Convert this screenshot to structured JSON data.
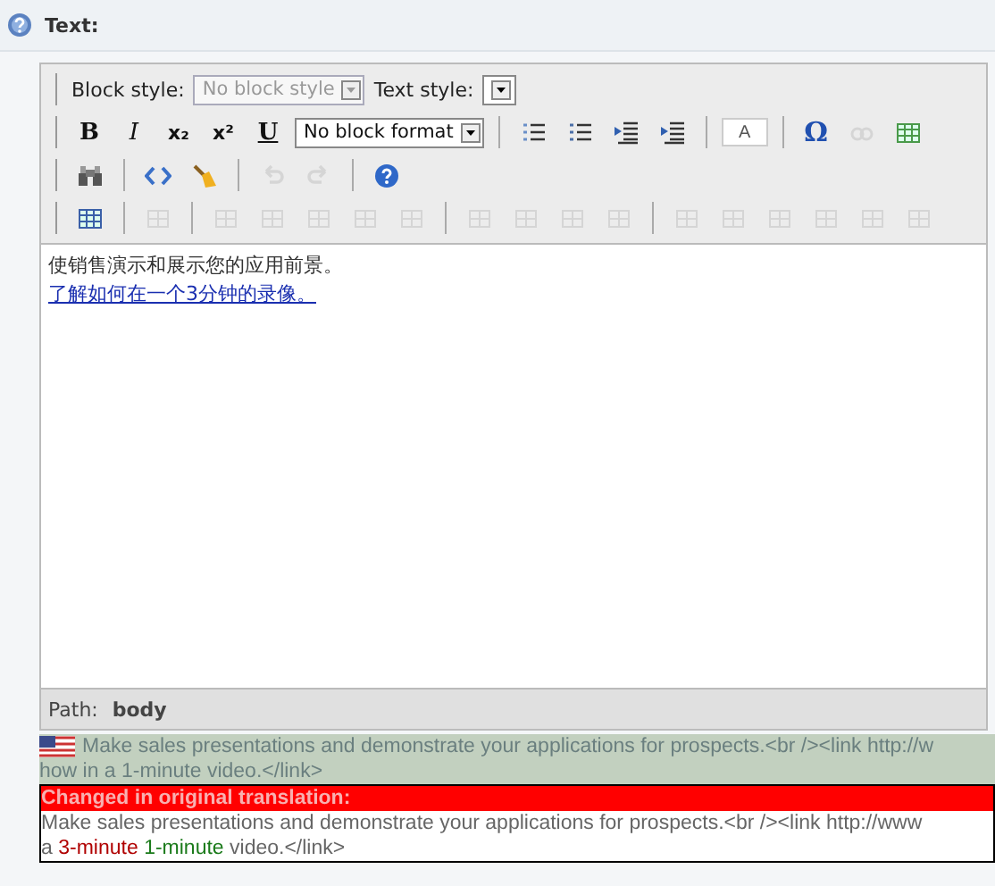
{
  "field": {
    "label": "Text:"
  },
  "toolbar": {
    "rows": [
      {
        "items": [
          {
            "kind": "label",
            "text": "Block style:"
          },
          {
            "kind": "select",
            "value": "No block style",
            "disabled": true
          },
          {
            "kind": "label",
            "text": "Text style:"
          },
          {
            "kind": "select",
            "disabled": false
          }
        ]
      },
      {
        "items": [
          {
            "kind": "glyph",
            "text": "B",
            "disabled": false
          },
          {
            "kind": "glyph",
            "text": "I",
            "disabled": false
          },
          {
            "kind": "glyph",
            "text": "x₂",
            "disabled": false
          },
          {
            "kind": "glyph",
            "text": "x²",
            "disabled": false
          },
          {
            "kind": "glyph",
            "text": "U",
            "disabled": false
          },
          {
            "kind": "select",
            "value": "No block format",
            "disabled": false
          },
          {
            "kind": "sep"
          },
          {
            "kind": "icon",
            "disabled": false
          },
          {
            "kind": "icon",
            "disabled": false
          },
          {
            "kind": "icon",
            "disabled": false
          },
          {
            "kind": "icon",
            "disabled": false
          },
          {
            "kind": "sep"
          },
          {
            "kind": "swatch",
            "text": "A",
            "disabled": false
          },
          {
            "kind": "sep"
          },
          {
            "kind": "glyph",
            "text": "Ω",
            "disabled": false
          },
          {
            "kind": "icon",
            "disabled": true
          },
          {
            "kind": "icon",
            "disabled": false
          }
        ]
      },
      {
        "items": [
          {
            "kind": "icon",
            "disabled": false
          },
          {
            "kind": "sep"
          },
          {
            "kind": "icon",
            "disabled": false
          },
          {
            "kind": "icon",
            "disabled": false
          },
          {
            "kind": "sep"
          },
          {
            "kind": "icon",
            "disabled": true
          },
          {
            "kind": "icon",
            "disabled": true
          },
          {
            "kind": "sep"
          },
          {
            "kind": "icon",
            "disabled": false
          }
        ]
      },
      {
        "items": [
          {
            "kind": "icon",
            "disabled": false
          },
          {
            "kind": "sep"
          },
          {
            "kind": "icon",
            "disabled": true
          },
          {
            "kind": "sep"
          },
          {
            "kind": "icon",
            "disabled": true
          },
          {
            "kind": "icon",
            "disabled": true
          },
          {
            "kind": "icon",
            "disabled": true
          },
          {
            "kind": "icon",
            "disabled": true
          },
          {
            "kind": "icon",
            "disabled": true
          },
          {
            "kind": "sep"
          },
          {
            "kind": "icon",
            "disabled": true
          },
          {
            "kind": "icon",
            "disabled": true
          },
          {
            "kind": "icon",
            "disabled": true
          },
          {
            "kind": "icon",
            "disabled": true
          },
          {
            "kind": "sep"
          },
          {
            "kind": "icon",
            "disabled": true
          },
          {
            "kind": "icon",
            "disabled": true
          },
          {
            "kind": "icon",
            "disabled": true
          },
          {
            "kind": "icon",
            "disabled": true
          },
          {
            "kind": "icon",
            "disabled": true
          },
          {
            "kind": "icon",
            "disabled": true
          }
        ]
      }
    ]
  },
  "content": {
    "paragraph": "使销售演示和展示您的应用前景。",
    "link": "了解如何在一个3分钟的录像。"
  },
  "path": {
    "label": "Path:",
    "value": "body"
  },
  "source": {
    "lines": [
      "Make sales presentations and demonstrate your applications for prospects.<br /><link http://w",
      "how in a 1-minute video.</link>"
    ]
  },
  "changed": {
    "title": "Changed in original translation:",
    "line_1": "Make sales presentations and demonstrate your applications for prospects.<br /><link http://www",
    "line_2": [
      {
        "kind": "plain",
        "text": "a"
      },
      {
        "kind": "removed",
        "text": "3-minute"
      },
      {
        "kind": "added",
        "text": "1-minute"
      },
      {
        "kind": "plain",
        "text": "video.</link>"
      }
    ]
  }
}
